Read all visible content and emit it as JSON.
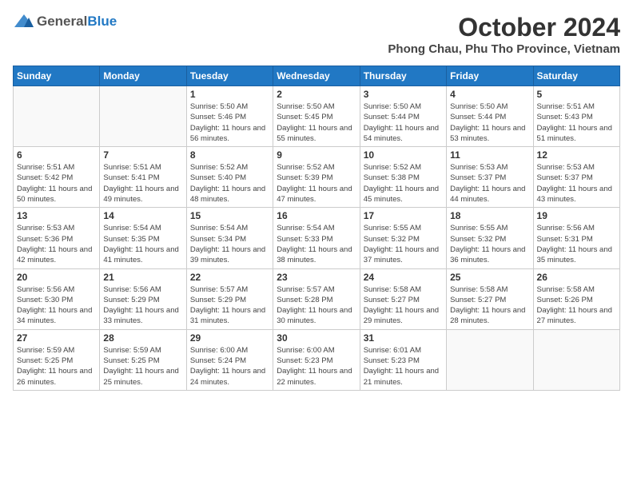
{
  "logo": {
    "general": "General",
    "blue": "Blue"
  },
  "title": "October 2024",
  "location": "Phong Chau, Phu Tho Province, Vietnam",
  "days_of_week": [
    "Sunday",
    "Monday",
    "Tuesday",
    "Wednesday",
    "Thursday",
    "Friday",
    "Saturday"
  ],
  "weeks": [
    [
      {
        "day": "",
        "sunrise": "",
        "sunset": "",
        "daylight": ""
      },
      {
        "day": "",
        "sunrise": "",
        "sunset": "",
        "daylight": ""
      },
      {
        "day": "1",
        "sunrise": "Sunrise: 5:50 AM",
        "sunset": "Sunset: 5:46 PM",
        "daylight": "Daylight: 11 hours and 56 minutes."
      },
      {
        "day": "2",
        "sunrise": "Sunrise: 5:50 AM",
        "sunset": "Sunset: 5:45 PM",
        "daylight": "Daylight: 11 hours and 55 minutes."
      },
      {
        "day": "3",
        "sunrise": "Sunrise: 5:50 AM",
        "sunset": "Sunset: 5:44 PM",
        "daylight": "Daylight: 11 hours and 54 minutes."
      },
      {
        "day": "4",
        "sunrise": "Sunrise: 5:50 AM",
        "sunset": "Sunset: 5:44 PM",
        "daylight": "Daylight: 11 hours and 53 minutes."
      },
      {
        "day": "5",
        "sunrise": "Sunrise: 5:51 AM",
        "sunset": "Sunset: 5:43 PM",
        "daylight": "Daylight: 11 hours and 51 minutes."
      }
    ],
    [
      {
        "day": "6",
        "sunrise": "Sunrise: 5:51 AM",
        "sunset": "Sunset: 5:42 PM",
        "daylight": "Daylight: 11 hours and 50 minutes."
      },
      {
        "day": "7",
        "sunrise": "Sunrise: 5:51 AM",
        "sunset": "Sunset: 5:41 PM",
        "daylight": "Daylight: 11 hours and 49 minutes."
      },
      {
        "day": "8",
        "sunrise": "Sunrise: 5:52 AM",
        "sunset": "Sunset: 5:40 PM",
        "daylight": "Daylight: 11 hours and 48 minutes."
      },
      {
        "day": "9",
        "sunrise": "Sunrise: 5:52 AM",
        "sunset": "Sunset: 5:39 PM",
        "daylight": "Daylight: 11 hours and 47 minutes."
      },
      {
        "day": "10",
        "sunrise": "Sunrise: 5:52 AM",
        "sunset": "Sunset: 5:38 PM",
        "daylight": "Daylight: 11 hours and 45 minutes."
      },
      {
        "day": "11",
        "sunrise": "Sunrise: 5:53 AM",
        "sunset": "Sunset: 5:37 PM",
        "daylight": "Daylight: 11 hours and 44 minutes."
      },
      {
        "day": "12",
        "sunrise": "Sunrise: 5:53 AM",
        "sunset": "Sunset: 5:37 PM",
        "daylight": "Daylight: 11 hours and 43 minutes."
      }
    ],
    [
      {
        "day": "13",
        "sunrise": "Sunrise: 5:53 AM",
        "sunset": "Sunset: 5:36 PM",
        "daylight": "Daylight: 11 hours and 42 minutes."
      },
      {
        "day": "14",
        "sunrise": "Sunrise: 5:54 AM",
        "sunset": "Sunset: 5:35 PM",
        "daylight": "Daylight: 11 hours and 41 minutes."
      },
      {
        "day": "15",
        "sunrise": "Sunrise: 5:54 AM",
        "sunset": "Sunset: 5:34 PM",
        "daylight": "Daylight: 11 hours and 39 minutes."
      },
      {
        "day": "16",
        "sunrise": "Sunrise: 5:54 AM",
        "sunset": "Sunset: 5:33 PM",
        "daylight": "Daylight: 11 hours and 38 minutes."
      },
      {
        "day": "17",
        "sunrise": "Sunrise: 5:55 AM",
        "sunset": "Sunset: 5:32 PM",
        "daylight": "Daylight: 11 hours and 37 minutes."
      },
      {
        "day": "18",
        "sunrise": "Sunrise: 5:55 AM",
        "sunset": "Sunset: 5:32 PM",
        "daylight": "Daylight: 11 hours and 36 minutes."
      },
      {
        "day": "19",
        "sunrise": "Sunrise: 5:56 AM",
        "sunset": "Sunset: 5:31 PM",
        "daylight": "Daylight: 11 hours and 35 minutes."
      }
    ],
    [
      {
        "day": "20",
        "sunrise": "Sunrise: 5:56 AM",
        "sunset": "Sunset: 5:30 PM",
        "daylight": "Daylight: 11 hours and 34 minutes."
      },
      {
        "day": "21",
        "sunrise": "Sunrise: 5:56 AM",
        "sunset": "Sunset: 5:29 PM",
        "daylight": "Daylight: 11 hours and 33 minutes."
      },
      {
        "day": "22",
        "sunrise": "Sunrise: 5:57 AM",
        "sunset": "Sunset: 5:29 PM",
        "daylight": "Daylight: 11 hours and 31 minutes."
      },
      {
        "day": "23",
        "sunrise": "Sunrise: 5:57 AM",
        "sunset": "Sunset: 5:28 PM",
        "daylight": "Daylight: 11 hours and 30 minutes."
      },
      {
        "day": "24",
        "sunrise": "Sunrise: 5:58 AM",
        "sunset": "Sunset: 5:27 PM",
        "daylight": "Daylight: 11 hours and 29 minutes."
      },
      {
        "day": "25",
        "sunrise": "Sunrise: 5:58 AM",
        "sunset": "Sunset: 5:27 PM",
        "daylight": "Daylight: 11 hours and 28 minutes."
      },
      {
        "day": "26",
        "sunrise": "Sunrise: 5:58 AM",
        "sunset": "Sunset: 5:26 PM",
        "daylight": "Daylight: 11 hours and 27 minutes."
      }
    ],
    [
      {
        "day": "27",
        "sunrise": "Sunrise: 5:59 AM",
        "sunset": "Sunset: 5:25 PM",
        "daylight": "Daylight: 11 hours and 26 minutes."
      },
      {
        "day": "28",
        "sunrise": "Sunrise: 5:59 AM",
        "sunset": "Sunset: 5:25 PM",
        "daylight": "Daylight: 11 hours and 25 minutes."
      },
      {
        "day": "29",
        "sunrise": "Sunrise: 6:00 AM",
        "sunset": "Sunset: 5:24 PM",
        "daylight": "Daylight: 11 hours and 24 minutes."
      },
      {
        "day": "30",
        "sunrise": "Sunrise: 6:00 AM",
        "sunset": "Sunset: 5:23 PM",
        "daylight": "Daylight: 11 hours and 22 minutes."
      },
      {
        "day": "31",
        "sunrise": "Sunrise: 6:01 AM",
        "sunset": "Sunset: 5:23 PM",
        "daylight": "Daylight: 11 hours and 21 minutes."
      },
      {
        "day": "",
        "sunrise": "",
        "sunset": "",
        "daylight": ""
      },
      {
        "day": "",
        "sunrise": "",
        "sunset": "",
        "daylight": ""
      }
    ]
  ]
}
